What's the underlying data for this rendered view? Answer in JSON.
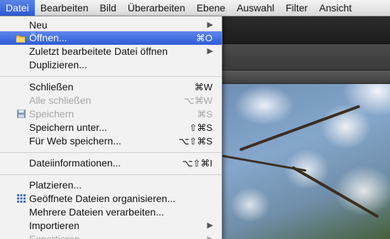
{
  "menubar": {
    "items": [
      "Datei",
      "Bearbeiten",
      "Bild",
      "Überarbeiten",
      "Ebene",
      "Auswahl",
      "Filter",
      "Ansicht"
    ]
  },
  "menu": {
    "items": [
      {
        "label": "Neu",
        "shortcut": "",
        "submenu": true,
        "disabled": false,
        "selected": false,
        "icon": ""
      },
      {
        "label": "Öffnen...",
        "shortcut": "⌘O",
        "submenu": false,
        "disabled": false,
        "selected": true,
        "icon": "folder-icon"
      },
      {
        "label": "Zuletzt bearbeitete Datei öffnen",
        "shortcut": "",
        "submenu": true,
        "disabled": false,
        "selected": false,
        "icon": ""
      },
      {
        "label": "Duplizieren...",
        "shortcut": "",
        "submenu": false,
        "disabled": false,
        "selected": false,
        "icon": ""
      },
      {
        "label": "Schließen",
        "shortcut": "⌘W",
        "submenu": false,
        "disabled": false,
        "selected": false,
        "icon": ""
      },
      {
        "label": "Alle schließen",
        "shortcut": "⌥⌘W",
        "submenu": false,
        "disabled": true,
        "selected": false,
        "icon": ""
      },
      {
        "label": "Speichern",
        "shortcut": "⌘S",
        "submenu": false,
        "disabled": true,
        "selected": false,
        "icon": "floppy-disk-icon"
      },
      {
        "label": "Speichern unter...",
        "shortcut": "⇧⌘S",
        "submenu": false,
        "disabled": false,
        "selected": false,
        "icon": ""
      },
      {
        "label": "Für Web speichern...",
        "shortcut": "⌥⇧⌘S",
        "submenu": false,
        "disabled": false,
        "selected": false,
        "icon": ""
      },
      {
        "label": "Dateiinformationen...",
        "shortcut": "⌥⇧⌘I",
        "submenu": false,
        "disabled": false,
        "selected": false,
        "icon": ""
      },
      {
        "label": "Platzieren...",
        "shortcut": "",
        "submenu": false,
        "disabled": false,
        "selected": false,
        "icon": ""
      },
      {
        "label": "Geöffnete Dateien organisieren...",
        "shortcut": "",
        "submenu": false,
        "disabled": false,
        "selected": false,
        "icon": "grid-icon"
      },
      {
        "label": "Mehrere Dateien verarbeiten...",
        "shortcut": "",
        "submenu": false,
        "disabled": false,
        "selected": false,
        "icon": ""
      },
      {
        "label": "Importieren",
        "shortcut": "",
        "submenu": true,
        "disabled": false,
        "selected": false,
        "icon": ""
      },
      {
        "label": "Exportieren",
        "shortcut": "",
        "submenu": true,
        "disabled": true,
        "selected": false,
        "icon": ""
      }
    ]
  },
  "colors": {
    "selection": "#3a66dd",
    "menu_bg": "#f2f2f2",
    "disabled_text": "#a6a6a6"
  }
}
